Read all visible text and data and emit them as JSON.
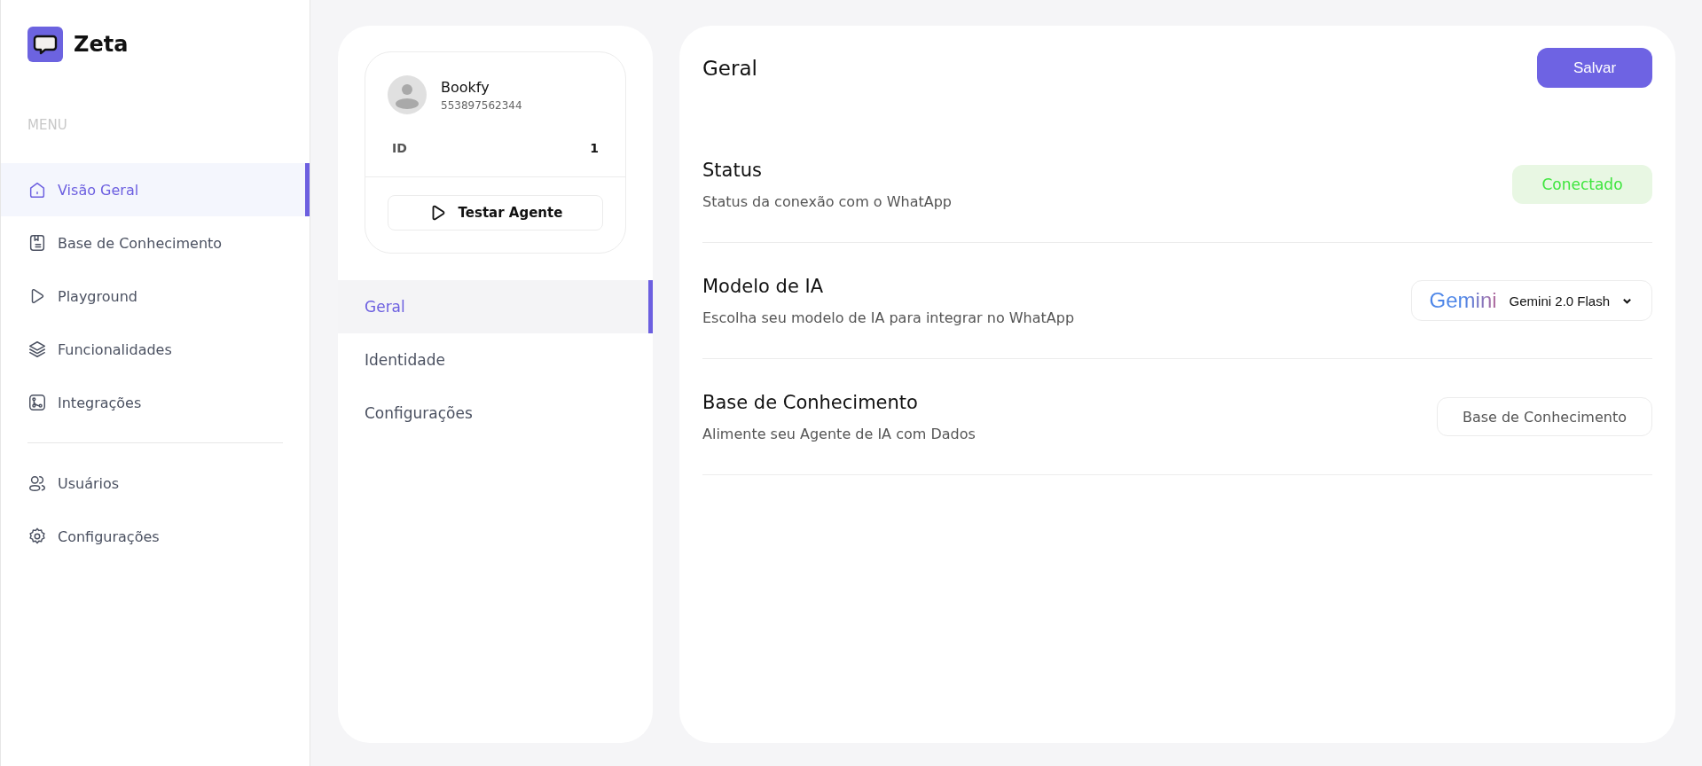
{
  "sidebar": {
    "brand": "Zeta",
    "section_label": "MENU",
    "items": [
      {
        "label": "Visão Geral",
        "selected": true
      },
      {
        "label": "Base de Conhecimento",
        "selected": false
      },
      {
        "label": "Playground",
        "selected": false
      },
      {
        "label": "Funcionalidades",
        "selected": false
      },
      {
        "label": "Integrações",
        "selected": false
      }
    ],
    "bottom_items": [
      {
        "label": "Usuários",
        "selected": false
      },
      {
        "label": "Configurações",
        "selected": false
      }
    ]
  },
  "agent": {
    "name": "Bookfy",
    "phone": "553897562344",
    "id_label": "ID",
    "id_value": "1",
    "test_button": "Testar Agente"
  },
  "agent_tabs": [
    {
      "label": "Geral",
      "selected": true
    },
    {
      "label": "Identidade",
      "selected": false
    },
    {
      "label": "Configurações",
      "selected": false
    }
  ],
  "panel": {
    "title": "Geral",
    "save_button": "Salvar",
    "rows": [
      {
        "kind": "status",
        "title": "Status",
        "description": "Status da conexão com o WhatApp",
        "value": "Conectado"
      },
      {
        "kind": "select",
        "title": "Modelo de IA",
        "description": "Escolha seu modelo de IA para integrar no WhatApp",
        "logo": "Gemini",
        "value": "Gemini 2.0 Flash"
      },
      {
        "kind": "button",
        "title": "Base de Conhecimento",
        "description": "Alimente seu Agente de IA com Dados",
        "value": "Base de Conhecimento"
      }
    ]
  }
}
